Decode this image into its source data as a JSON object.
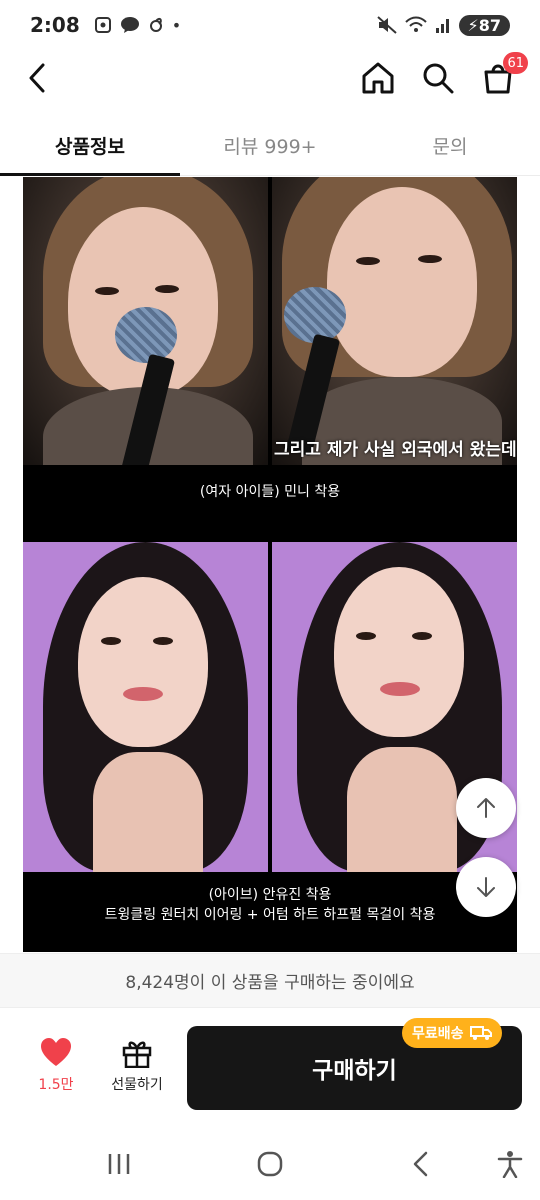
{
  "status_bar": {
    "time": "2:08",
    "battery": "87"
  },
  "header": {
    "cart_badge": "61"
  },
  "tabs": [
    {
      "label": "상품정보",
      "active": true
    },
    {
      "label": "리뷰 999+",
      "active": false
    },
    {
      "label": "문의",
      "active": false
    }
  ],
  "content": {
    "subtitle_overlay": "그리고 제가 사실 외국에서 왔는데",
    "caption_top": "(여자 아이들) 민니 착용",
    "caption_bottom_line1": "(아이브) 안유진 착용",
    "caption_bottom_line2": "트윙클링 원터치 이어링 + 어텀  하트 하프펄 목걸이 착용"
  },
  "buying_now_text": "8,424명이 이 상품을 구매하는 중이에요",
  "buy_bar": {
    "like_count": "1.5만",
    "gift_label": "선물하기",
    "purchase_label": "구매하기",
    "free_shipping_label": "무료배송"
  },
  "colors": {
    "accent_red": "#f0414b",
    "purchase_black": "#161616",
    "free_ship_orange": "#ffb11b",
    "photo_purple": "#b784d6"
  }
}
